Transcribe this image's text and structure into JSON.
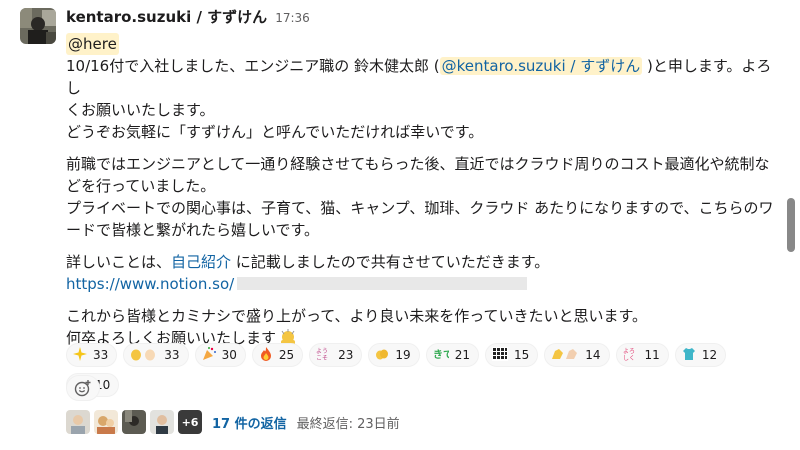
{
  "header": {
    "username": "kentaro.suzuki / すずけん",
    "time": "17:36"
  },
  "body": {
    "here": "@here",
    "p1a": "10/16付で入社しました、エンジニア職の 鈴木健太郎 (",
    "p1_mention": "@kentaro.suzuki / すずけん",
    "p1b": " )と申します。よろし",
    "p1c": "くお願いいたします。",
    "p1d": "どうぞお気軽に「すずけん」と呼んでいただければ幸いです。",
    "p2a": "前職ではエンジニアとして一通り経験させてもらった後、直近ではクラウド周りのコスト最適化や統制な",
    "p2b": "どを行っていました。",
    "p2c": "プライベートでの関心事は、子育て、猫、キャンプ、珈琲、クラウド あたりになりますので、こちらのワ",
    "p2d": "ードで皆様と繋がれたら嬉しいです。",
    "p3a": "詳しいことは、",
    "p3_link": "自己紹介",
    "p3b": " に記載しましたので共有させていただきます。",
    "url": "https://www.notion.so/",
    "p4a": "これから皆様とカミナシで盛り上がって、より良い未来を作っていきたいと思います。",
    "p4b": "何卒よろしくお願いいたします"
  },
  "reactions": [
    {
      "icon": "sparkles-icon",
      "count": "33"
    },
    {
      "icon": "clap-icon",
      "count": "33"
    },
    {
      "icon": "party-popper-icon",
      "count": "30"
    },
    {
      "icon": "fire-icon",
      "count": "25"
    },
    {
      "icon": "welcome-text-icon",
      "count": "23"
    },
    {
      "icon": "clap-small-icon",
      "count": "19"
    },
    {
      "icon": "kite-text-icon",
      "count": "21"
    },
    {
      "icon": "grid-text-icon",
      "count": "15"
    },
    {
      "icon": "muscle-icon",
      "count": "14"
    },
    {
      "icon": "yoroshiku-icon",
      "count": "11"
    },
    {
      "icon": "shirt-icon",
      "count": "12"
    },
    {
      "icon": "bow-icon",
      "count": "10"
    }
  ],
  "thread": {
    "more": "+6",
    "replies": "17 件の返信",
    "last_reply": "最終返信: 23日前"
  },
  "colors": {
    "mention_bg": "#fff2c9",
    "link": "#1264a3"
  }
}
